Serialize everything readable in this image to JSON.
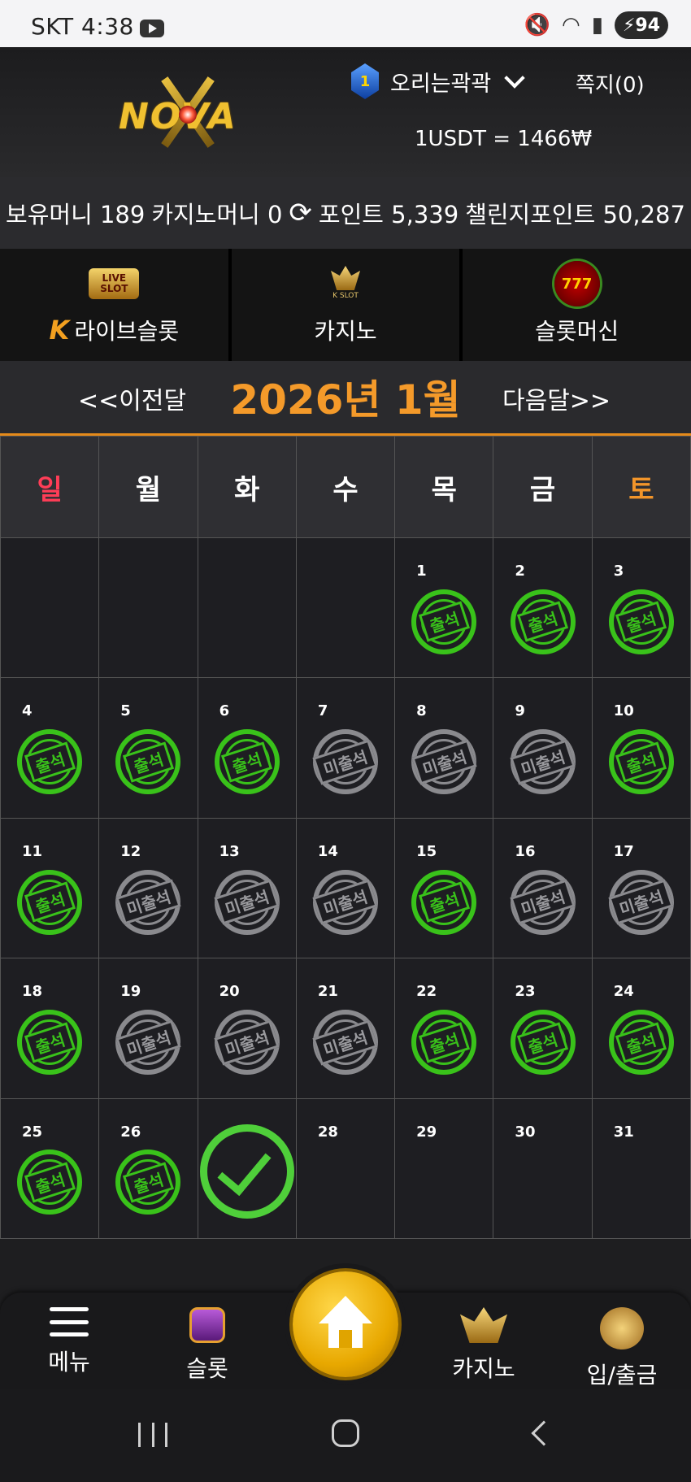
{
  "status_bar": {
    "carrier_time": "SKT 4:38",
    "battery": "94"
  },
  "header": {
    "logo": "NOVA",
    "level": "1",
    "username": "오리는곽곽",
    "messages": "쪽지(0)",
    "exchange_rate": "1USDT = 1466₩"
  },
  "balances": {
    "money": "보유머니 189",
    "casino_money": "카지노머니 0",
    "points": "포인트 5,339",
    "challenge_points": "챌린지포인트 50,287"
  },
  "categories": [
    {
      "label": "라이브슬롯",
      "icon": "live-slot-icon",
      "icon_text_1": "LIVE",
      "icon_text_2": "SLOT"
    },
    {
      "label": "카지노",
      "icon": "kslot-crown-icon",
      "icon_text_1": "K SLOT"
    },
    {
      "label": "슬롯머신",
      "icon": "777-slots-icon",
      "icon_text_1": "777"
    }
  ],
  "calendar": {
    "prev_label": "<<이전달",
    "next_label": "다음달>>",
    "title": "2026년 1월",
    "weekdays": [
      "일",
      "월",
      "화",
      "수",
      "목",
      "금",
      "토"
    ],
    "stamp_attended": "출석",
    "stamp_absent": "미출석",
    "days": [
      {
        "n": "",
        "s": "none"
      },
      {
        "n": "",
        "s": "none"
      },
      {
        "n": "",
        "s": "none"
      },
      {
        "n": "",
        "s": "none"
      },
      {
        "n": "1",
        "s": "attended"
      },
      {
        "n": "2",
        "s": "attended"
      },
      {
        "n": "3",
        "s": "attended"
      },
      {
        "n": "4",
        "s": "attended"
      },
      {
        "n": "5",
        "s": "attended"
      },
      {
        "n": "6",
        "s": "attended"
      },
      {
        "n": "7",
        "s": "absent"
      },
      {
        "n": "8",
        "s": "absent"
      },
      {
        "n": "9",
        "s": "absent"
      },
      {
        "n": "10",
        "s": "attended"
      },
      {
        "n": "11",
        "s": "attended"
      },
      {
        "n": "12",
        "s": "absent"
      },
      {
        "n": "13",
        "s": "absent"
      },
      {
        "n": "14",
        "s": "absent"
      },
      {
        "n": "15",
        "s": "attended"
      },
      {
        "n": "16",
        "s": "absent"
      },
      {
        "n": "17",
        "s": "absent"
      },
      {
        "n": "18",
        "s": "attended"
      },
      {
        "n": "19",
        "s": "absent"
      },
      {
        "n": "20",
        "s": "absent"
      },
      {
        "n": "21",
        "s": "absent"
      },
      {
        "n": "22",
        "s": "attended"
      },
      {
        "n": "23",
        "s": "attended"
      },
      {
        "n": "24",
        "s": "attended"
      },
      {
        "n": "25",
        "s": "attended"
      },
      {
        "n": "26",
        "s": "attended"
      },
      {
        "n": "",
        "s": "today"
      },
      {
        "n": "28",
        "s": "none"
      },
      {
        "n": "29",
        "s": "none"
      },
      {
        "n": "30",
        "s": "none"
      },
      {
        "n": "31",
        "s": "none"
      }
    ]
  },
  "bottom_nav": {
    "menu": "메뉴",
    "slot": "슬롯",
    "casino": "카지노",
    "deposit": "입/출금"
  }
}
